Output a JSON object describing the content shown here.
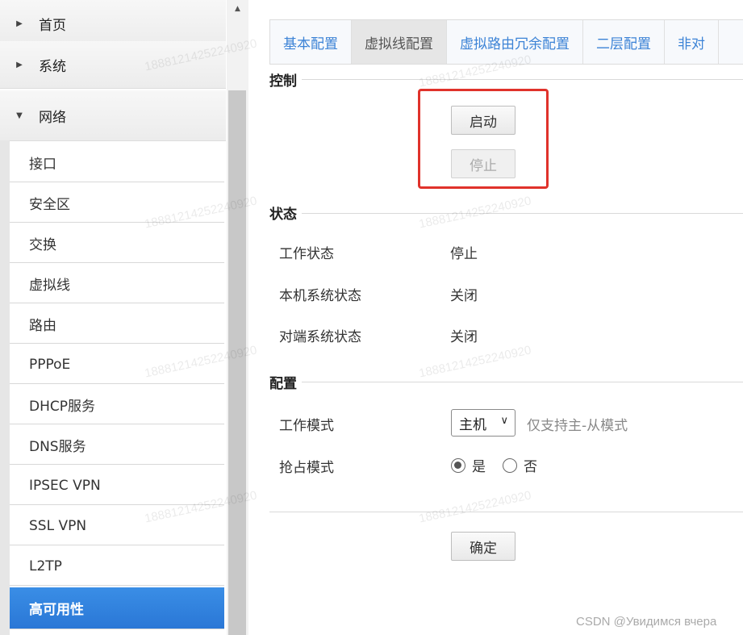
{
  "sidebar": {
    "groups": [
      {
        "label": "首页",
        "expanded": false
      },
      {
        "label": "系统",
        "expanded": false
      },
      {
        "label": "网络",
        "expanded": true
      }
    ],
    "items": [
      {
        "label": "接口"
      },
      {
        "label": "安全区"
      },
      {
        "label": "交换"
      },
      {
        "label": "虚拟线"
      },
      {
        "label": "路由"
      },
      {
        "label": "PPPoE"
      },
      {
        "label": "DHCP服务"
      },
      {
        "label": "DNS服务"
      },
      {
        "label": "IPSEC VPN"
      },
      {
        "label": "SSL VPN"
      },
      {
        "label": "L2TP"
      },
      {
        "label": "高可用性",
        "active": true
      }
    ]
  },
  "tabs": [
    {
      "label": "基本配置"
    },
    {
      "label": "虚拟线配置",
      "active": true
    },
    {
      "label": "虚拟路由冗余配置"
    },
    {
      "label": "二层配置"
    },
    {
      "label": "非对"
    }
  ],
  "control": {
    "title": "控制",
    "start_label": "启动",
    "stop_label": "停止"
  },
  "status": {
    "title": "状态",
    "rows": [
      {
        "label": "工作状态",
        "value": "停止"
      },
      {
        "label": "本机系统状态",
        "value": "关闭"
      },
      {
        "label": "对端系统状态",
        "value": "关闭"
      }
    ]
  },
  "config": {
    "title": "配置",
    "work_mode_label": "工作模式",
    "work_mode_value": "主机",
    "work_mode_hint": "仅支持主-从模式",
    "preempt_label": "抢占模式",
    "preempt_yes": "是",
    "preempt_no": "否",
    "preempt_selected": "是"
  },
  "confirm_label": "确定",
  "watermark_text": "18881214252240920",
  "credit": "CSDN @Увидимся вчера",
  "colors": {
    "accent": "#3c83d6",
    "active_item": "#2a77d6",
    "highlight": "#e0322b"
  }
}
